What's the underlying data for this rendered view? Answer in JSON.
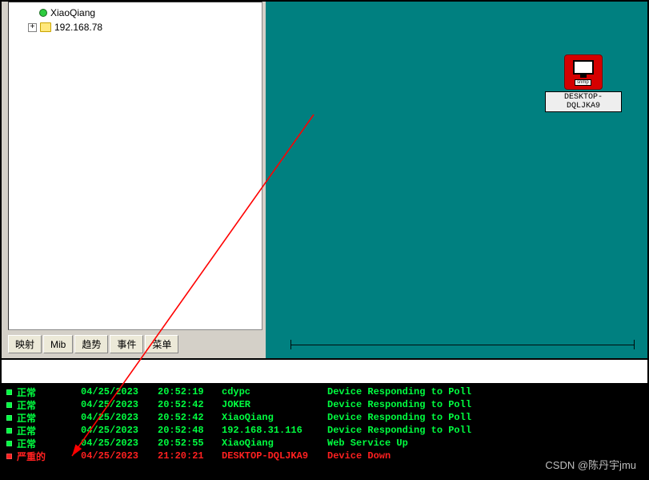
{
  "tree": {
    "items": [
      {
        "label": "XiaoQiang",
        "icon": "device"
      },
      {
        "label": "192.168.78",
        "icon": "folder",
        "expander": "+"
      }
    ]
  },
  "tabs": [
    "映射",
    "Mib",
    "趋势",
    "事件",
    "菜单"
  ],
  "canvas_icon": {
    "label": "DESKTOP-DQLJKA9",
    "tag": "snmp"
  },
  "log": {
    "lines": [
      {
        "severity": "正常",
        "date": "04/25/2023",
        "time": "20:52:19",
        "host": "cdypc",
        "msg": "Device Responding to Poll",
        "cls": "green"
      },
      {
        "severity": "正常",
        "date": "04/25/2023",
        "time": "20:52:42",
        "host": "JOKER",
        "msg": "Device Responding to Poll",
        "cls": "green"
      },
      {
        "severity": "正常",
        "date": "04/25/2023",
        "time": "20:52:42",
        "host": "XiaoQiang",
        "msg": "Device Responding to Poll",
        "cls": "green"
      },
      {
        "severity": "正常",
        "date": "04/25/2023",
        "time": "20:52:48",
        "host": "192.168.31.116",
        "msg": "Device Responding to Poll",
        "cls": "green"
      },
      {
        "severity": "正常",
        "date": "04/25/2023",
        "time": "20:52:55",
        "host": "XiaoQiang",
        "msg": "Web Service Up",
        "cls": "green"
      },
      {
        "severity": "严重的",
        "date": "04/25/2023",
        "time": "21:20:21",
        "host": "DESKTOP-DQLJKA9",
        "msg": "Device Down",
        "cls": "red"
      }
    ]
  },
  "watermark": "CSDN @陈丹宇jmu"
}
